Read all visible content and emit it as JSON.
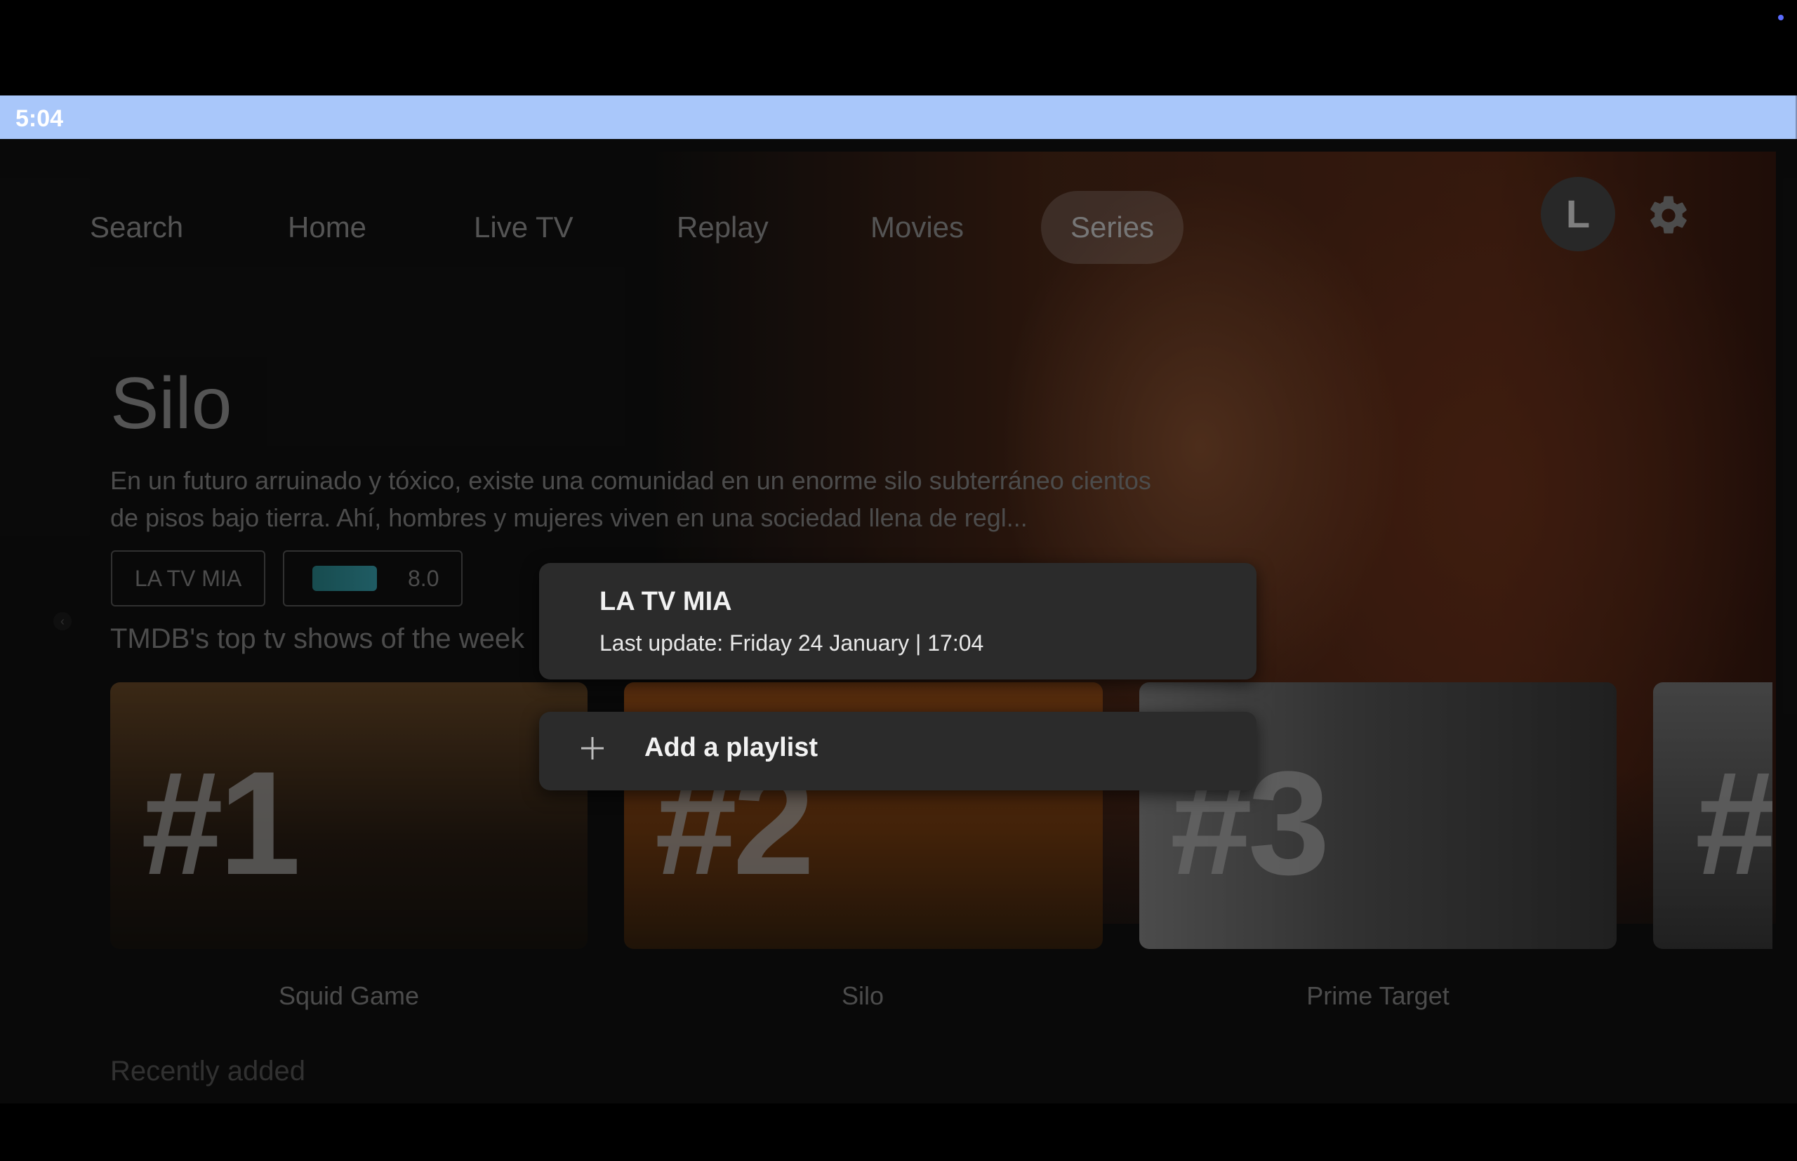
{
  "status_bar": {
    "time": "5:04"
  },
  "nav": {
    "items": [
      "Search",
      "Home",
      "Live TV",
      "Replay",
      "Movies",
      "Series"
    ],
    "active": "Series",
    "avatar_letter": "L"
  },
  "hero": {
    "title": "Silo",
    "description": "En un futuro arruinado y tóxico, existe una comunidad en un enorme silo subterráneo cientos de pisos bajo tierra. Ahí, hombres y mujeres viven en una sociedad llena de regl...",
    "source_chip": "LA TV MIA",
    "rating": "8.0"
  },
  "top_row": {
    "title": "TMDB's top tv shows of the week",
    "cards": [
      {
        "rank": "#1",
        "label": "Squid Game",
        "tint": "#3a2a1a"
      },
      {
        "rank": "#2",
        "label": "Silo",
        "tint": "#8a4a14"
      },
      {
        "rank": "#3",
        "label": "Prime Target",
        "tint": "#5e5e5e"
      },
      {
        "rank": "#",
        "label": "",
        "tint": "#4a4a4a"
      }
    ]
  },
  "next_row": {
    "title": "Recently added"
  },
  "playlist_menu": {
    "playlist_name": "LA TV MIA",
    "last_update": "Last update: Friday 24 January | 17:04",
    "add_label": "Add a playlist"
  }
}
